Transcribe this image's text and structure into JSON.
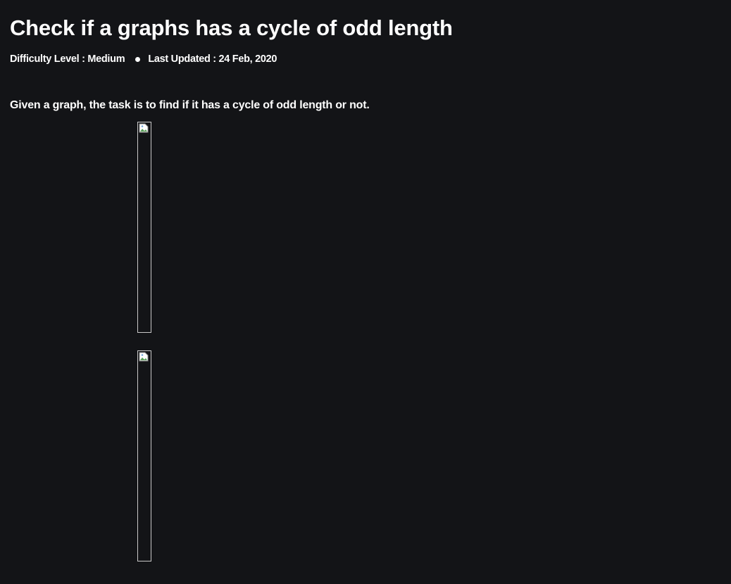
{
  "article": {
    "title": "Check if a graphs has a cycle of odd length",
    "difficulty": "Difficulty Level : Medium",
    "last_updated": "Last Updated : 24 Feb, 2020",
    "intro": "Given a graph, the task is to find if it has a cycle of odd length or not."
  },
  "images": [
    {
      "icon": "broken-image-icon"
    },
    {
      "icon": "broken-image-icon"
    }
  ],
  "colors": {
    "background": "#131417",
    "text": "#ffffff",
    "image_border": "#c9c9c9"
  }
}
